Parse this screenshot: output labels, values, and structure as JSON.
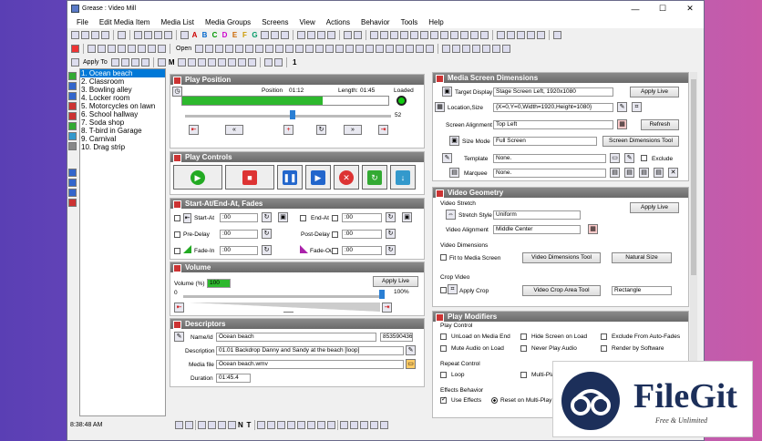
{
  "window": {
    "title": "Grease : Video Mill"
  },
  "menu": [
    "File",
    "Edit Media Item",
    "Media List",
    "Media Groups",
    "Screens",
    "View",
    "Actions",
    "Behavior",
    "Tools",
    "Help"
  ],
  "toolbar": {
    "letters": [
      "A",
      "B",
      "C",
      "D",
      "E",
      "F",
      "G"
    ],
    "apply_to": "Apply To",
    "open": "Open",
    "m_label": "M",
    "n_label": "N",
    "t_label": "T",
    "one_label": "1"
  },
  "media_list": [
    "1. Ocean beach",
    "2. Classroom",
    "3. Bowling alley",
    "4. Locker room",
    "5. Motorcycles on lawn",
    "6. School hallway",
    "7. Soda shop",
    "8. T-bird in Garage",
    "9. Carnival",
    "10. Drag strip"
  ],
  "play_position": {
    "header": "Play Position",
    "position_label": "Position",
    "position": "01:12",
    "length_label": "Length:",
    "length": "01:45",
    "loaded_label": "Loaded",
    "progress_fraction": 0.68,
    "slider_value": "52",
    "slider_fraction": 0.52
  },
  "play_controls": {
    "header": "Play Controls"
  },
  "start_end": {
    "header": "Start-At/End-At, Fades",
    "start_at": "Start-At",
    "end_at": "End-At",
    "pre_delay": "Pre-Delay",
    "post_delay": "Post-Delay",
    "fade_in": "Fade-In",
    "fade_out": "Fade-Out",
    "value": ":00"
  },
  "volume": {
    "header": "Volume",
    "label": "Volume (%)",
    "value": "100",
    "apply_live": "Apply Live",
    "min": "0",
    "max": "100%",
    "slider_fraction": 1.0
  },
  "descriptors": {
    "header": "Descriptors",
    "name_label": "Name/Id",
    "name": "Ocean beach",
    "id": "853590436",
    "desc_label": "Description",
    "desc": "01.01  Backdrop Danny and Sandy at the beach [loop]",
    "file_label": "Media file",
    "file": "Ocean beach.wmv",
    "duration_label": "Duration",
    "duration": "01:45.4"
  },
  "msd": {
    "header": "Media Screen Dimensions",
    "target_label": "Target Display",
    "target": "Stage Screen Left, 1920x1080",
    "apply_live": "Apply Live",
    "loc_label": "Location,Size",
    "loc": "{X=0,Y=0,Width=1920,Height=1080}",
    "align_label": "Screen Alignment",
    "align": "Top Left",
    "refresh": "Refresh",
    "size_mode_label": "Size Mode",
    "size_mode": "Full Screen",
    "sdt": "Screen Dimensions Tool",
    "template_label": "Template",
    "template": "None.",
    "exclude": "Exclude",
    "marquee_label": "Marquee",
    "marquee": "None."
  },
  "vg": {
    "header": "Video Geometry",
    "stretch_group": "Video Stretch",
    "stretch_label": "Stretch Style",
    "stretch": "Uniform",
    "apply_live": "Apply Live",
    "valign_label": "Video Alignment",
    "valign": "Middle Center",
    "dims_group": "Video Dimensions",
    "fit": "Fit to Media Screen",
    "vdt": "Video Dimensions Tool",
    "natural": "Natural Size",
    "crop_group": "Crop Video",
    "apply_crop": "Apply Crop",
    "vcat": "Video Crop Area Tool",
    "crop_shape": "Rectangle"
  },
  "pm": {
    "header": "Play Modifiers",
    "play_control": "Play Control",
    "unload": "UnLoad on Media End",
    "hide": "Hide Screen on Load",
    "exclude_fades": "Exclude From Auto-Fades",
    "mute": "Mute Audio on Load",
    "never_play": "Never Play Audio",
    "render_sw": "Render by Software",
    "repeat_control": "Repeat Control",
    "loop": "Loop",
    "multi_play": "Multi-Pla",
    "effects_behavior": "Effects Behavior",
    "use_effects": "Use Effects",
    "reset": "Reset on Multi-Play"
  },
  "status": {
    "time": "8:38:48 AM"
  },
  "watermark": {
    "brand": "FileGit",
    "tagline": "Free & Unlimited"
  }
}
